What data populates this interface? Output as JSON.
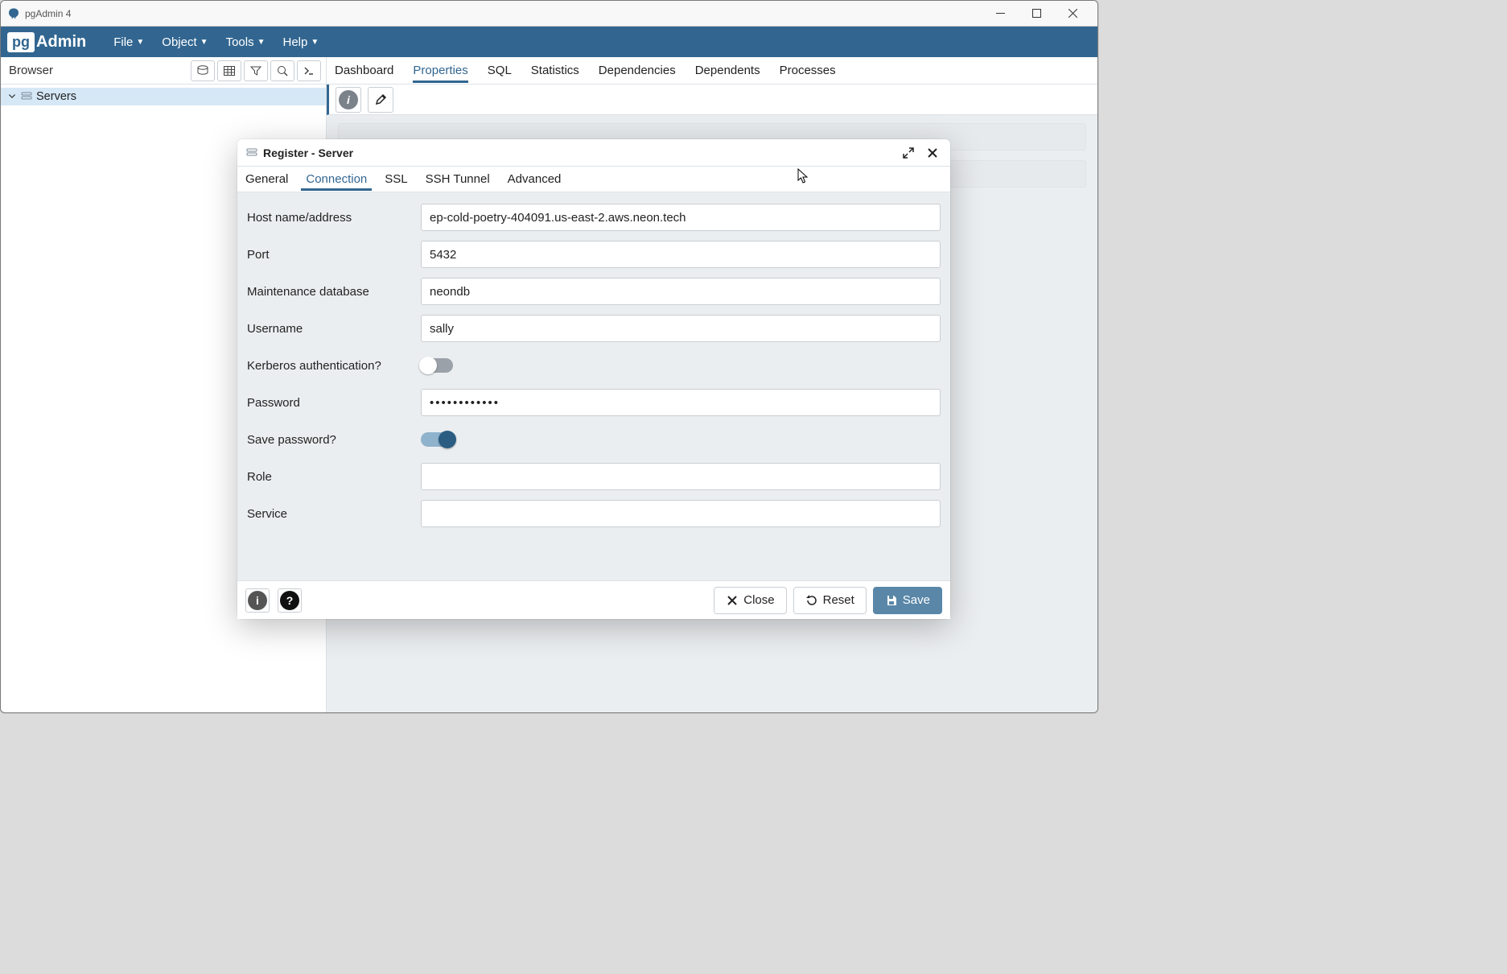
{
  "os_title": "pgAdmin 4",
  "logo": {
    "pg": "pg",
    "admin": "Admin"
  },
  "menus": [
    "File",
    "Object",
    "Tools",
    "Help"
  ],
  "browser": {
    "title": "Browser",
    "tree_root": "Servers"
  },
  "tabs": [
    "Dashboard",
    "Properties",
    "SQL",
    "Statistics",
    "Dependencies",
    "Dependents",
    "Processes"
  ],
  "tabs_active_index": 1,
  "dialog": {
    "title": "Register - Server",
    "tabs": [
      "General",
      "Connection",
      "SSL",
      "SSH Tunnel",
      "Advanced"
    ],
    "tabs_active_index": 1,
    "form": {
      "host_label": "Host name/address",
      "host_value": "ep-cold-poetry-404091.us-east-2.aws.neon.tech",
      "port_label": "Port",
      "port_value": "5432",
      "maintdb_label": "Maintenance database",
      "maintdb_value": "neondb",
      "user_label": "Username",
      "user_value": "sally",
      "kerberos_label": "Kerberos authentication?",
      "kerberos_on": false,
      "password_label": "Password",
      "password_value": "••••••••••••",
      "savepw_label": "Save password?",
      "savepw_on": true,
      "role_label": "Role",
      "role_value": "",
      "service_label": "Service",
      "service_value": ""
    },
    "buttons": {
      "close": "Close",
      "reset": "Reset",
      "save": "Save"
    }
  }
}
